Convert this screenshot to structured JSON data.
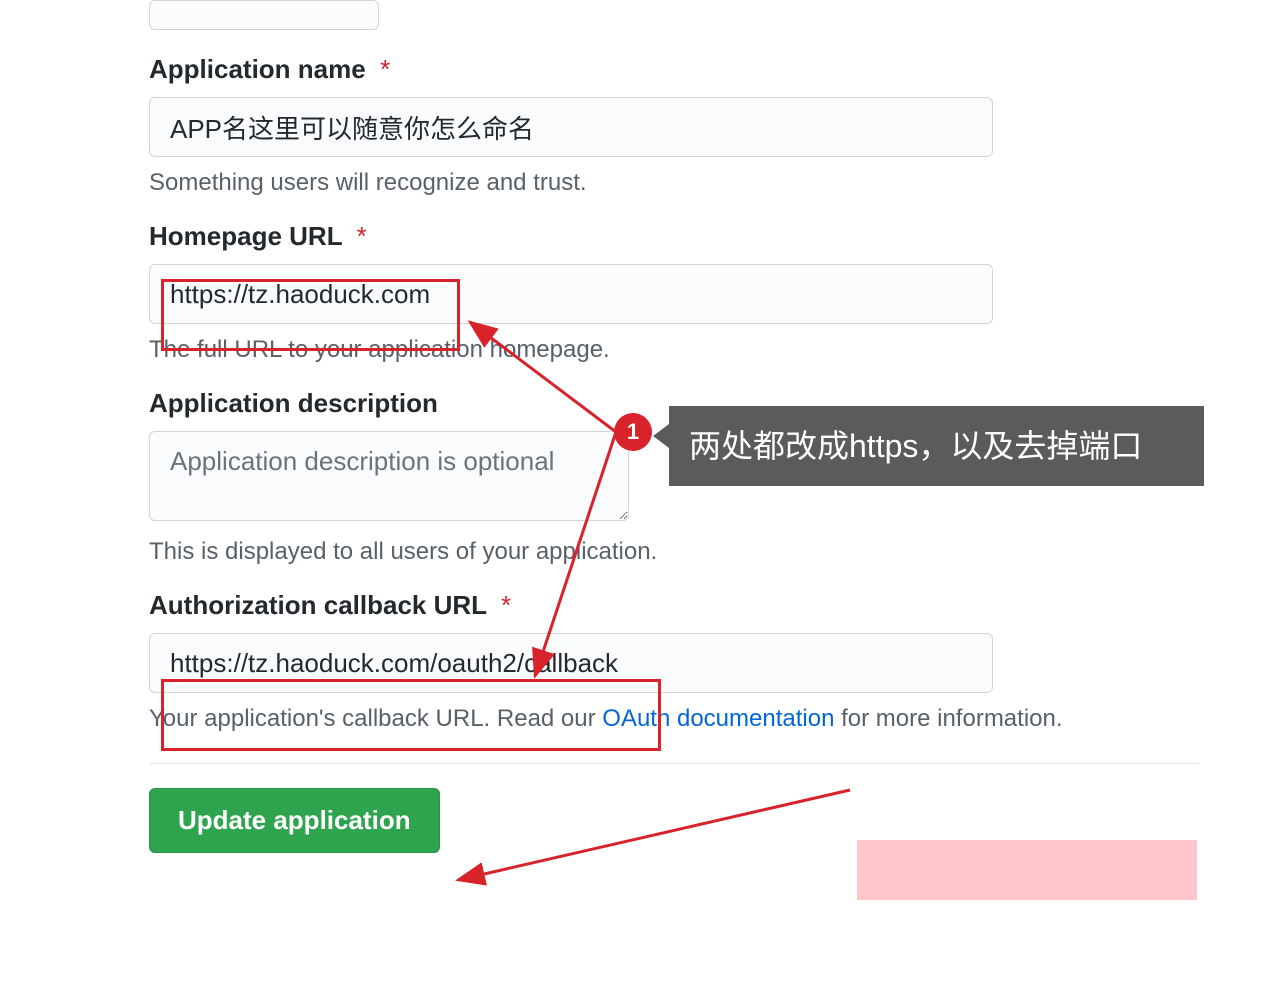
{
  "form": {
    "appName": {
      "label": "Application name",
      "value": "APP名这里可以随意你怎么命名",
      "help": "Something users will recognize and trust."
    },
    "homepage": {
      "label": "Homepage URL",
      "value": "https://tz.haoduck.com",
      "help": "The full URL to your application homepage."
    },
    "description": {
      "label": "Application description",
      "placeholder": "Application description is optional",
      "help": "This is displayed to all users of your application."
    },
    "callback": {
      "label": "Authorization callback URL",
      "value": "https://tz.haoduck.com/oauth2/callback",
      "helpPrefix": "Your application's callback URL. Read our ",
      "helpLink": "OAuth documentation",
      "helpSuffix": " for more information."
    },
    "submit": {
      "label": "Update application"
    }
  },
  "annotation": {
    "badge": "1",
    "text": "两处都改成https，以及去掉端口"
  }
}
